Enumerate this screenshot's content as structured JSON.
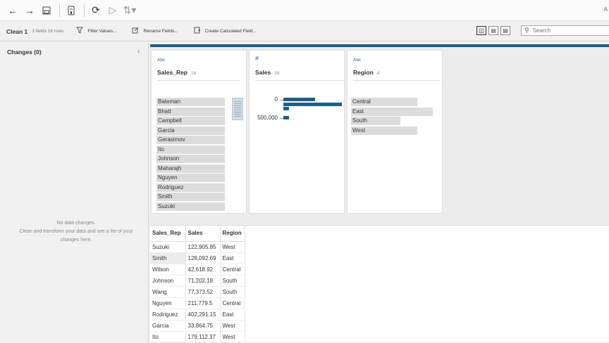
{
  "topbar": {
    "right_text": "A"
  },
  "toolbar": {
    "step_name": "Clean 1",
    "step_meta": "3 fields  16 rows",
    "filter_label": "Filter Values...",
    "rename_label": "Rename Fields...",
    "calc_label": "Create Calculated Field...",
    "search_placeholder": "Search"
  },
  "changes": {
    "title": "Changes (0)",
    "empty_title": "No data changes.",
    "empty_body_1": "Clean and transform your data and see a list of your",
    "empty_body_2": "changes here."
  },
  "profile": {
    "cards": [
      {
        "type_label": "Abc",
        "name": "Sales_Rep",
        "count": "16",
        "values": [
          "Bateman",
          "Bhatt",
          "Campbell",
          "Garcia",
          "Gerasimov",
          "Ito",
          "Johnson",
          "Maharajh",
          "Nguyen",
          "Rodriguez",
          "Smith",
          "Suzuki"
        ]
      },
      {
        "type_label": "#",
        "name": "Sales",
        "count": "16",
        "bins": [
          {
            "label": "0",
            "counts": [
              6,
              11,
              1
            ]
          },
          {
            "label": "500,000",
            "counts": [
              1
            ]
          }
        ]
      },
      {
        "type_label": "Abc",
        "name": "Region",
        "count": "4",
        "values": [
          {
            "label": "Central",
            "share": 0.78
          },
          {
            "label": "East",
            "share": 0.97
          },
          {
            "label": "South",
            "share": 0.58
          },
          {
            "label": "West",
            "share": 0.78
          }
        ]
      }
    ]
  },
  "grid": {
    "headers": [
      "Sales_Rep",
      "Sales",
      "Region"
    ],
    "rows": [
      [
        "Suzuki",
        "122,905.85",
        "West"
      ],
      [
        "Smith",
        "128,092.69",
        "East"
      ],
      [
        "Wilson",
        "42,618.92",
        "Central"
      ],
      [
        "Johnson",
        "71,202.18",
        "South"
      ],
      [
        "Wang",
        "77,373.52",
        "South"
      ],
      [
        "Nguyen",
        "211,779.5",
        "Central"
      ],
      [
        "Rodriguez",
        "402,291.15",
        "East"
      ],
      [
        "Garcia",
        "33,864.75",
        "West"
      ],
      [
        "Ito",
        "179,112.37",
        "West"
      ]
    ]
  }
}
